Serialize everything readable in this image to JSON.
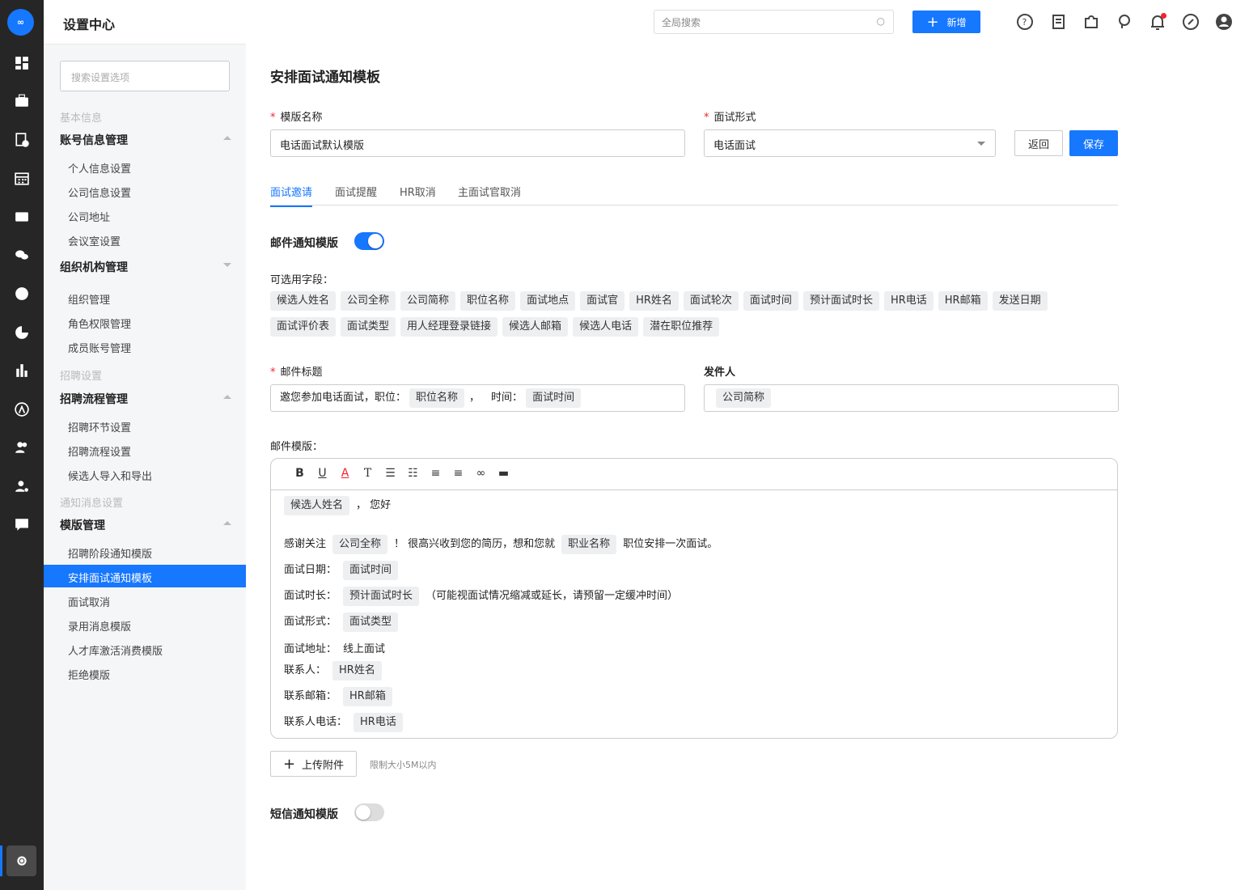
{
  "app": {
    "logo_text": "∞",
    "title": "设置中心"
  },
  "header": {
    "search_placeholder": "全局搜索",
    "add_label": "新增"
  },
  "panel": {
    "search_placeholder": "搜索设置选项",
    "groups": [
      "基本信息",
      "招聘设置",
      "通知消息设置"
    ],
    "sections": [
      "账号信息管理",
      "组织机构管理",
      "招聘流程管理",
      "模版管理"
    ],
    "items": [
      "个人信息设置",
      "公司信息设置",
      "公司地址",
      "会议室设置",
      "组织管理",
      "角色权限管理",
      "成员账号管理",
      "招聘环节设置",
      "招聘流程设置",
      "候选人导入和导出",
      "招聘阶段通知模版",
      "安排面试通知模板",
      "面试取消",
      "录用消息模版",
      "人才库激活消费模版",
      "拒绝模版"
    ]
  },
  "form": {
    "title": "安排面试通知模板",
    "req_mark": "*",
    "name_label": "模版名称",
    "name_value": "电话面试默认模版",
    "type_label": "面试形式",
    "type_value": "电话面试",
    "back_label": "返回",
    "save_label": "保存",
    "tabs": [
      "面试邀请",
      "面试提醒",
      "HR取消",
      "主面试官取消"
    ],
    "email_toggle_label": "邮件通知模版",
    "email_enabled": true,
    "fields_label": "可选用字段：",
    "fields": [
      "候选人姓名",
      "公司全称",
      "公司简称",
      "职位名称",
      "面试地点",
      "面试官",
      "HR姓名",
      "面试轮次",
      "面试时间",
      "预计面试时长",
      "HR电话",
      "HR邮箱",
      "发送日期",
      "面试评价表",
      "面试类型",
      "用人经理登录链接",
      "候选人邮箱",
      "候选人电话",
      "潜在职位推荐"
    ],
    "subject_label": "邮件标题",
    "subject": {
      "t1": "邀您参加电话面试，职位：",
      "tag1": "职位名称",
      "t2": "，",
      "t3": "时间：",
      "tag2": "面试时间"
    },
    "sender_label": "发件人",
    "sender_tag": "公司简称",
    "template_label": "邮件模版：",
    "body": {
      "l1_tag": "候选人姓名",
      "l1_text": "，  您好",
      "l2_a": "感谢关注",
      "l2_tag1": "公司全称",
      "l2_b": "！  很高兴收到您的简历，想和您就",
      "l2_tag2": "职业名称",
      "l2_c": "职位安排一次面试。",
      "date_label": "面试日期：",
      "date_tag": "面试时间",
      "dur_label": "面试时长：",
      "dur_tag": "预计面试时长",
      "dur_note": "（可能视面试情况缩减或延长，请预留一定缓冲时间）",
      "form_label": "面试形式：",
      "form_tag": "面试类型",
      "addr_label": "面试地址：",
      "addr_value": "线上面试",
      "contact_label": "联系人：",
      "contact_tag": "HR姓名",
      "mail_label": "联系邮箱：",
      "mail_tag": "HR邮箱",
      "phone_label": "联系人电话：",
      "phone_tag": "HR电话"
    },
    "upload_label": "上传附件",
    "upload_hint": "限制大小5M以内",
    "sms_toggle_label": "短信通知模版",
    "sms_enabled": false
  }
}
